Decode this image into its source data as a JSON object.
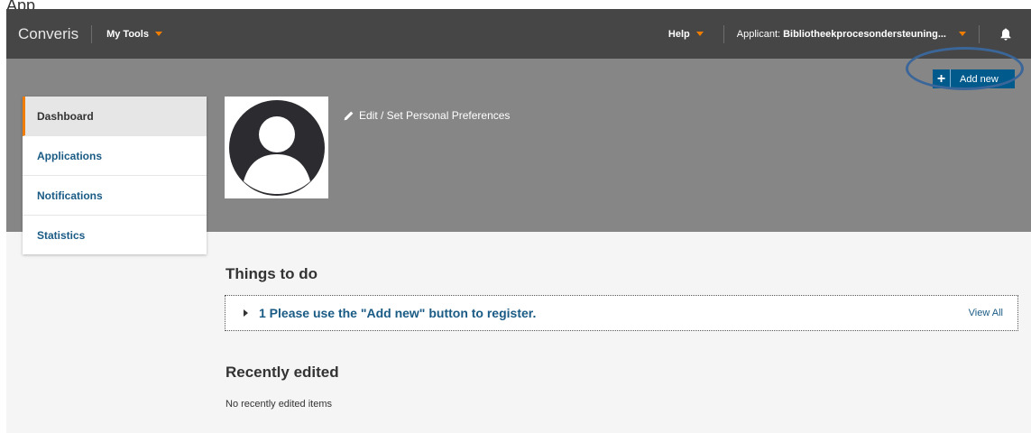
{
  "page": {
    "corner_label": "App"
  },
  "header": {
    "brand": "Converis",
    "my_tools_label": "My Tools",
    "help_label": "Help",
    "applicant_prefix": "Applicant:",
    "applicant_name": "Bibliotheekprocesondersteuning...",
    "icons": {
      "bell": "bell-icon",
      "caret": "caret-down-icon"
    }
  },
  "banner": {
    "add_new_label": "Add new",
    "add_new_icon": "plus-icon",
    "edit_prefs_label": "Edit / Set Personal Preferences",
    "edit_icon": "pencil-icon",
    "avatar_icon": "user-avatar-icon"
  },
  "sidebar": {
    "items": [
      {
        "label": "Dashboard",
        "active": true
      },
      {
        "label": "Applications",
        "active": false
      },
      {
        "label": "Notifications",
        "active": false
      },
      {
        "label": "Statistics",
        "active": false
      }
    ]
  },
  "main": {
    "things_to_do_title": "Things to do",
    "todo_item": "1 Please use the \"Add new\" button to register.",
    "view_all_label": "View All",
    "recently_edited_title": "Recently edited",
    "recently_edited_empty": "No recently edited items"
  },
  "colors": {
    "topbar": "#464646",
    "banner": "#868686",
    "accent_orange": "#f07c00",
    "primary_blue": "#005a8c",
    "link_blue": "#1a5b85",
    "annotation_ring": "#3b6699"
  }
}
